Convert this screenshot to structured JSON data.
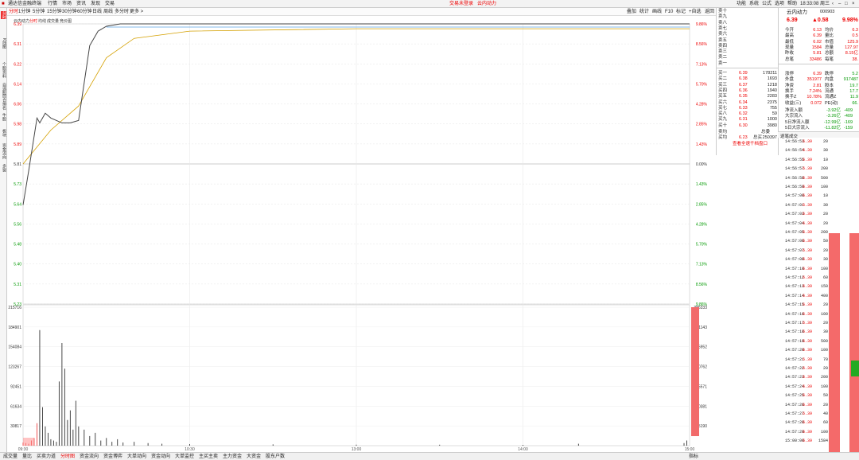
{
  "topbar": {
    "code": "通达信金融终端",
    "menu": [
      "行情",
      "市场",
      "资讯",
      "发现",
      "交易"
    ],
    "center": [
      "交易未登录",
      "云内动力"
    ],
    "right": [
      "功能",
      "系统",
      "公式",
      "选项",
      "帮助"
    ],
    "time": "18:33:08 周三"
  },
  "left_toolbar": [
    "分时",
    "K线图",
    "个股资料",
    "自选股",
    "综合排名",
    "牛股",
    "板块",
    "资金流向",
    "多窗",
    "AI",
    "星"
  ],
  "chart_tabs": [
    "分时",
    "1分钟",
    "5分钟",
    "15分钟",
    "30分钟",
    "60分钟",
    "日线",
    "周线",
    "多分时",
    "更多 >"
  ],
  "chart_tabs_right": [
    "叠加",
    "统计",
    "画线",
    "F10",
    "标记",
    "+自选",
    "返回"
  ],
  "sub_tabs": [
    "云内动力",
    "分时",
    "均线",
    "成交量",
    "竞价图"
  ],
  "chart_data": {
    "type": "line",
    "price_axis": [
      "6.39",
      "6.31",
      "6.22",
      "6.14",
      "6.06",
      "5.98",
      "5.89",
      "5.81",
      "5.73",
      "5.64",
      "5.56",
      "5.48",
      "5.40",
      "5.31",
      "5.23"
    ],
    "pct_axis": [
      "9.86%",
      "8.56%",
      "7.13%",
      "5.70%",
      "4.28%",
      "2.85%",
      "1.43%",
      "0.00%",
      "1.43%",
      "2.85%",
      "4.28%",
      "5.70%",
      "7.13%",
      "8.56%",
      "9.86%"
    ],
    "time_ticks": [
      "09:30",
      "10:30",
      "13:00",
      "14:00",
      "15:00"
    ],
    "prev_close": 5.81,
    "price": {
      "x": [
        0,
        2,
        5,
        6,
        8,
        10,
        14,
        17,
        20,
        24,
        27,
        30,
        35,
        40,
        60,
        120,
        240
      ],
      "y": [
        5.64,
        5.78,
        6.0,
        5.98,
        6.02,
        6.0,
        5.98,
        5.98,
        5.99,
        6.3,
        6.36,
        6.38,
        6.39,
        6.39,
        6.39,
        6.39,
        6.39
      ]
    },
    "avg": {
      "x": [
        0,
        10,
        20,
        30,
        40,
        60,
        120,
        180,
        240
      ],
      "y": [
        5.81,
        5.95,
        6.05,
        6.25,
        6.33,
        6.36,
        6.37,
        6.37,
        6.37
      ]
    },
    "vol_axis": [
      "215716",
      "184901",
      "154084",
      "123267",
      "92451",
      "61634",
      "30817"
    ],
    "vol_axis_right": [
      "386333",
      "331143",
      "275952",
      "220762",
      "165571",
      "110381",
      "55190"
    ],
    "volume": {
      "x": [
        0,
        1,
        2,
        3,
        4,
        5,
        6,
        7,
        8,
        9,
        10,
        11,
        12,
        13,
        14,
        15,
        16,
        17,
        18,
        19,
        20,
        22,
        24,
        26,
        28,
        30,
        32,
        34,
        36,
        40,
        45,
        50,
        60,
        90,
        120,
        150,
        180,
        200,
        238,
        239
      ],
      "y": [
        5000,
        4000,
        3000,
        8000,
        12000,
        35000,
        180000,
        60000,
        30000,
        20000,
        10000,
        8000,
        6000,
        100000,
        160000,
        120000,
        40000,
        55000,
        25000,
        70000,
        30000,
        25000,
        15000,
        20000,
        8000,
        12000,
        6000,
        10000,
        5000,
        6000,
        4000,
        3000,
        2500,
        2000,
        1500,
        1500,
        1200,
        3000,
        4000,
        8000
      ]
    }
  },
  "orderbook": {
    "sell_labels": [
      "卖十",
      "卖九",
      "卖八",
      "卖七",
      "卖六",
      "卖五",
      "卖四",
      "卖三",
      "卖二",
      "卖一"
    ],
    "buy": [
      {
        "l": "买一",
        "p": "6.39",
        "v": "178211"
      },
      {
        "l": "买二",
        "p": "6.38",
        "v": "1693"
      },
      {
        "l": "买三",
        "p": "6.37",
        "v": "1218"
      },
      {
        "l": "买四",
        "p": "6.36",
        "v": "1940"
      },
      {
        "l": "买五",
        "p": "6.35",
        "v": "2283"
      },
      {
        "l": "买六",
        "p": "6.34",
        "v": "2375"
      },
      {
        "l": "买七",
        "p": "6.33",
        "v": "755"
      },
      {
        "l": "买八",
        "p": "6.32",
        "v": "59"
      },
      {
        "l": "买九",
        "p": "6.31",
        "v": "1000"
      },
      {
        "l": "买十",
        "p": "6.30",
        "v": "3980"
      }
    ],
    "sell_avg": "卖均",
    "sell_total": "总委",
    "buy_avg_label": "买均",
    "buy_avg": "6.23",
    "buy_total_label": "总买",
    "buy_total": "250397",
    "link": "查看全速千档盘口"
  },
  "info": {
    "name": "云内动力",
    "code": "000903",
    "price": "6.39",
    "change": "▲0.58",
    "pct": "9.98%",
    "rows": [
      [
        "今开",
        "6.13",
        "均价",
        "6.3"
      ],
      [
        "最高",
        "6.39",
        "量比",
        "0.5"
      ],
      [
        "最低",
        "6.02",
        "市值",
        "125.9"
      ],
      [
        "现量",
        "1584",
        "总量",
        "127.97"
      ],
      [
        "昨收",
        "5.81",
        "总额",
        "8.15亿"
      ],
      [
        "总笔",
        "33486",
        "每笔",
        "38."
      ]
    ],
    "rows2": [
      [
        "涨停",
        "6.39",
        "跌停",
        "5.2"
      ],
      [
        "外盘",
        "351977",
        "内盘",
        "917487"
      ],
      [
        "净资",
        "2.81",
        "股本",
        "19.7"
      ],
      [
        "换手",
        "7.24%",
        "流通",
        "17.7"
      ],
      [
        "换手Z",
        "10.78%",
        "流通Z",
        "11.9"
      ],
      [
        "收益(三)",
        "0.072",
        "PE(动)",
        "66."
      ]
    ],
    "flow": [
      [
        "净流入额",
        "-3.92亿",
        "-409"
      ],
      [
        "大宗流入",
        "-3.26亿",
        "-409"
      ],
      [
        "5日净流入额",
        "-12.99亿",
        "-169"
      ],
      [
        "5日大宗流入",
        "-11.82亿",
        "-159"
      ]
    ],
    "trade_tab": "逐笔成交"
  },
  "trades": {
    "times": [
      "14:56:53",
      "14:56:54",
      "14:56:55",
      "14:56:57",
      "14:56:58",
      "14:56:59",
      "14:57:00",
      "14:57:01",
      "14:57:03",
      "14:57:04",
      "14:57:05",
      "14:57:06",
      "14:57:07",
      "14:57:08",
      "14:57:10",
      "14:57:12",
      "14:57:13",
      "14:57:14",
      "14:57:15",
      "14:57:16",
      "14:57:17",
      "14:57:18",
      "14:57:19",
      "14:57:20",
      "14:57:21",
      "14:57:22",
      "14:57:23",
      "14:57:24",
      "14:57:25",
      "14:57:26",
      "14:57:27",
      "14:57:28",
      "14:57:29",
      "15:00:00"
    ],
    "price": "6.39",
    "vols": [
      "20",
      "30",
      "10",
      "200",
      "500",
      "100",
      "10",
      "30",
      "20",
      "20",
      "200",
      "50",
      "20",
      "30",
      "100",
      "60",
      "150",
      "400",
      "20",
      "100",
      "20",
      "30",
      "500",
      "100",
      "70",
      "20",
      "200",
      "100",
      "50",
      "20",
      "40",
      "60",
      "100",
      "1584"
    ]
  },
  "bottom_tabs": [
    "成交量",
    "量比",
    "买卖力道",
    "分时图",
    "资金流向",
    "资金博弈",
    "大单动向",
    "资金动向",
    "大单监控",
    "主买主卖",
    "主力资金",
    "大资金",
    "股东户数"
  ],
  "bottom_right": "指标"
}
